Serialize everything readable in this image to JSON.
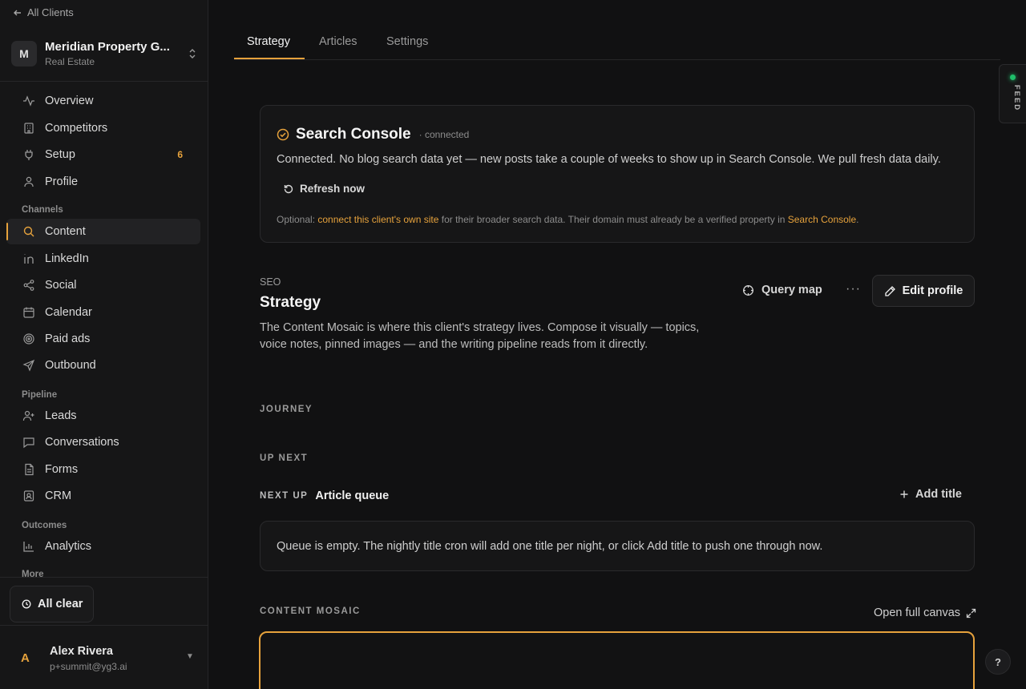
{
  "sidebar": {
    "back_label": "All Clients",
    "client": {
      "initial": "M",
      "name": "Meridian Property G...",
      "industry": "Real Estate"
    },
    "nav_main": [
      {
        "label": "Overview",
        "icon": "activity-icon"
      },
      {
        "label": "Competitors",
        "icon": "building-icon"
      },
      {
        "label": "Setup",
        "icon": "plug-icon",
        "badge": "6"
      },
      {
        "label": "Profile",
        "icon": "user-icon"
      }
    ],
    "channels_label": "Channels",
    "channels": [
      {
        "label": "Content",
        "icon": "search-icon",
        "active": true
      },
      {
        "label": "LinkedIn",
        "icon": "linkedin-icon"
      },
      {
        "label": "Social",
        "icon": "share-icon"
      },
      {
        "label": "Calendar",
        "icon": "calendar-icon"
      },
      {
        "label": "Paid ads",
        "icon": "target-icon"
      },
      {
        "label": "Outbound",
        "icon": "send-icon"
      }
    ],
    "pipeline_label": "Pipeline",
    "pipeline": [
      {
        "label": "Leads",
        "icon": "user-plus-icon"
      },
      {
        "label": "Conversations",
        "icon": "message-icon"
      },
      {
        "label": "Forms",
        "icon": "document-icon"
      },
      {
        "label": "CRM",
        "icon": "contact-card-icon"
      }
    ],
    "outcomes_label": "Outcomes",
    "outcomes": [
      {
        "label": "Analytics",
        "icon": "bar-chart-icon"
      }
    ],
    "more_label": "More",
    "status_label": "All clear",
    "user": {
      "initial": "A",
      "name": "Alex Rivera",
      "email": "p+summit@yg3.ai"
    }
  },
  "tabs": [
    {
      "label": "Strategy",
      "active": true
    },
    {
      "label": "Articles"
    },
    {
      "label": "Settings"
    }
  ],
  "feed_label": "FEED",
  "search_console": {
    "title": "Search Console",
    "status": "· connected",
    "description": "Connected. No blog search data yet — new posts take a couple of weeks to show up in Search Console. We pull fresh data daily.",
    "refresh_label": "Refresh now",
    "note_prefix": "Optional: ",
    "note_link": "connect this client's own site",
    "note_middle": " for their broader search data. Their domain must already be a verified property in ",
    "note_link2": "Search Console",
    "note_suffix": "."
  },
  "strategy": {
    "kicker": "SEO",
    "title": "Strategy",
    "description": "The Content Mosaic is where this client's strategy lives. Compose it visually — topics, voice notes, pinned images — and the writing pipeline reads from it directly.",
    "query_map_label": "Query map",
    "more_label": "···",
    "edit_label": "Edit profile"
  },
  "journey_label": "JOURNEY",
  "up_next_label": "UP NEXT",
  "next_up": {
    "tag": "NEXT UP",
    "name": "Article queue",
    "add_label": "Add title",
    "empty_text": "Queue is empty. The nightly title cron will add one title per night, or click Add title to push one through now."
  },
  "mosaic": {
    "label": "CONTENT MOSAIC",
    "open_label": "Open full canvas"
  },
  "help_label": "?",
  "colors": {
    "accent": "#e6a23c",
    "feed_dot": "#1fbf6a",
    "background": "#111112"
  }
}
